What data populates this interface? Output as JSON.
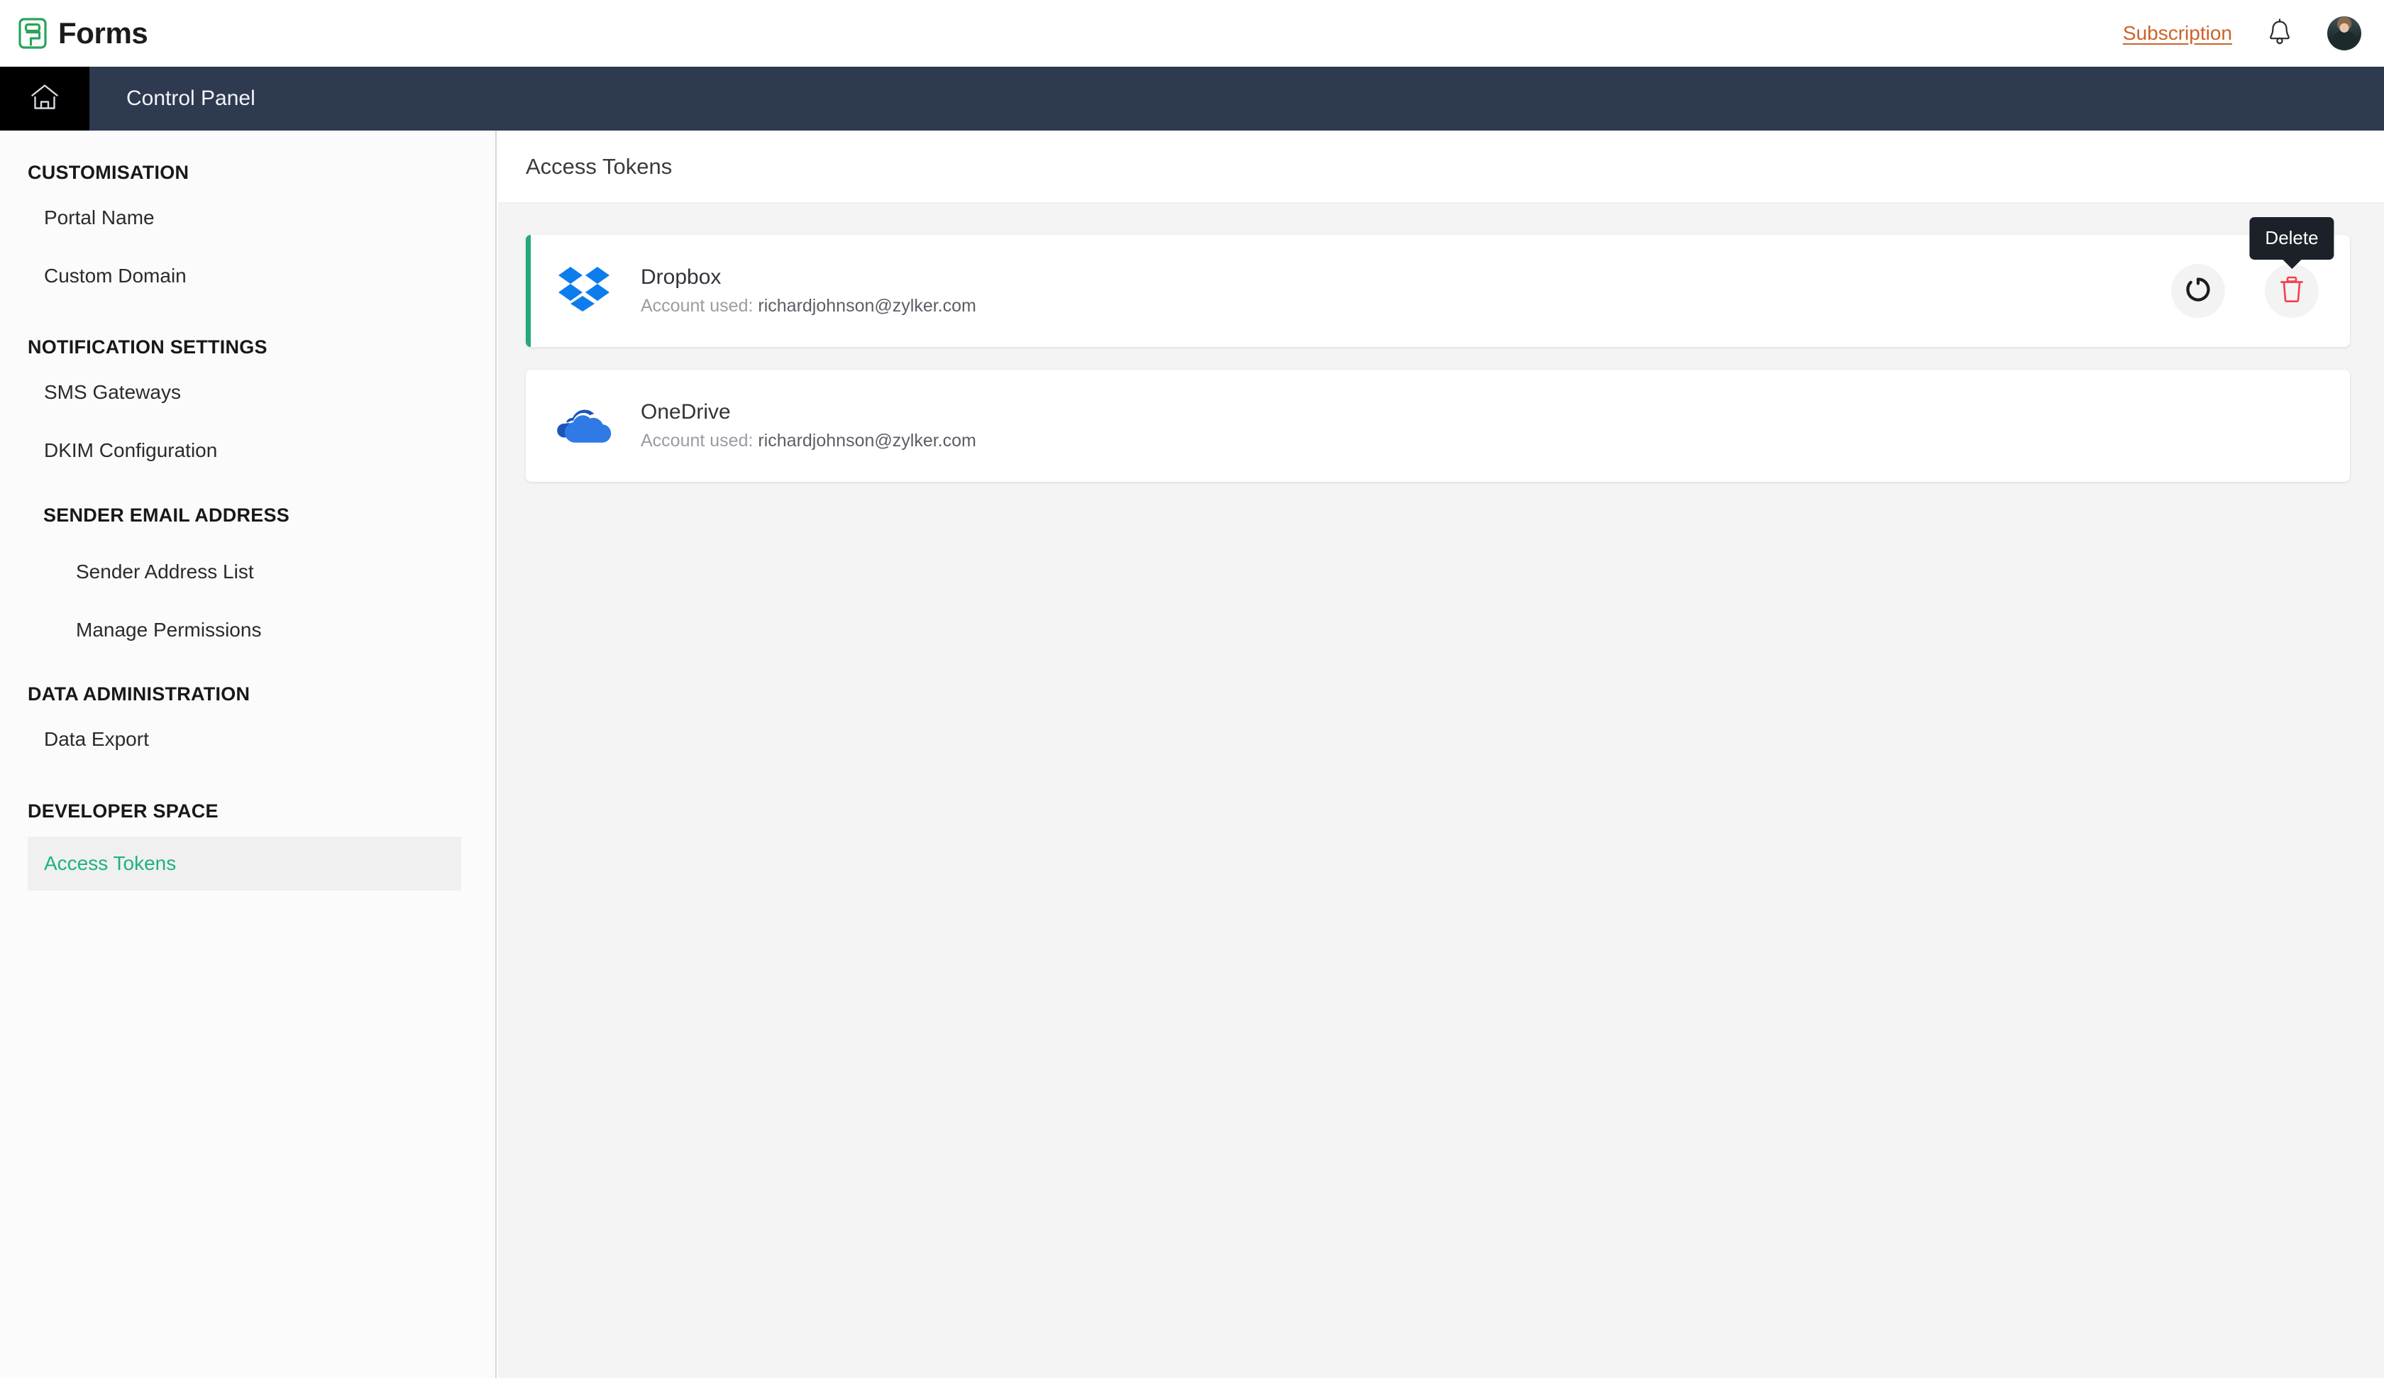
{
  "header": {
    "brand_name": "Forms",
    "brand_icon": "forms-logo-icon",
    "subscription_label": "Subscription",
    "bell_icon": "notification-bell-icon",
    "avatar_icon": "user-avatar"
  },
  "navbar": {
    "home_icon": "home-icon",
    "title": "Control Panel"
  },
  "sidebar": {
    "groups": [
      {
        "heading": "CUSTOMISATION",
        "items": [
          {
            "label": "Portal Name",
            "active": false
          },
          {
            "label": "Custom Domain",
            "active": false
          }
        ]
      },
      {
        "heading": "NOTIFICATION SETTINGS",
        "items": [
          {
            "label": "SMS Gateways",
            "active": false
          },
          {
            "label": "DKIM Configuration",
            "active": false
          }
        ]
      },
      {
        "heading": "SENDER EMAIL ADDRESS",
        "items": [
          {
            "label": "Sender Address List",
            "active": false
          },
          {
            "label": "Manage Permissions",
            "active": false
          }
        ]
      },
      {
        "heading": "DATA ADMINISTRATION",
        "items": [
          {
            "label": "Data Export",
            "active": false
          }
        ]
      },
      {
        "heading": "DEVELOPER SPACE",
        "items": [
          {
            "label": "Access Tokens",
            "active": true
          }
        ]
      }
    ]
  },
  "main": {
    "title": "Access Tokens",
    "account_label": "Account used:",
    "cards": [
      {
        "name": "Dropbox",
        "icon": "dropbox-icon",
        "account_label": "Account used:",
        "account_email": "richardjohnson@zylker.com",
        "accent": true,
        "actions": {
          "refresh_icon": "refresh-token-icon",
          "delete_icon": "trash-delete-icon",
          "tooltip": "Delete"
        }
      },
      {
        "name": "OneDrive",
        "icon": "onedrive-icon",
        "account_label": "Account used:",
        "account_email": "richardjohnson@zylker.com",
        "accent": false,
        "actions": null
      }
    ]
  },
  "colors": {
    "accent_green": "#22a97e",
    "link_orange": "#cb622a",
    "navbar_navy": "#2e3a50",
    "delete_red": "#f43f4f",
    "tooltip_bg": "#1b2029",
    "dropbox_blue": "#0d7ded",
    "onedrive_blue": "#2068d8"
  }
}
